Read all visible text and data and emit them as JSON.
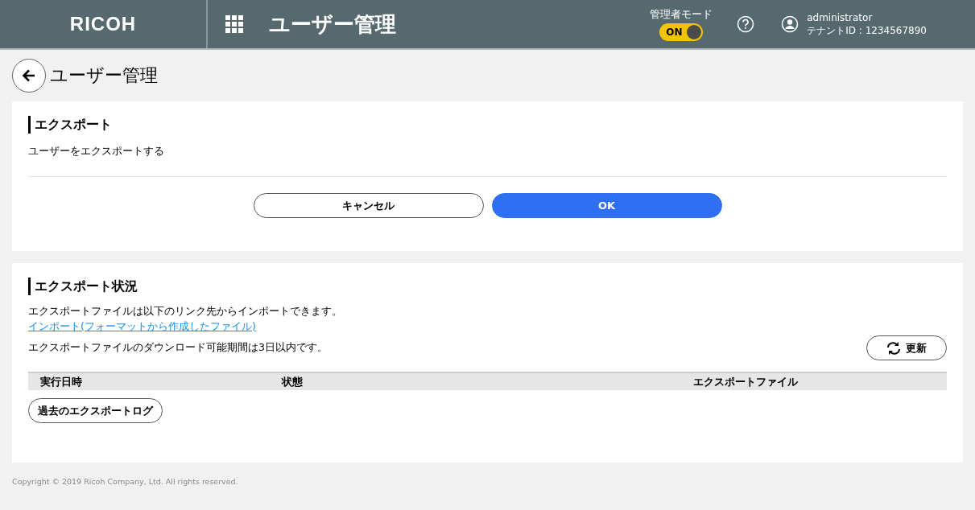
{
  "header": {
    "logo": "RICOH",
    "title": "ユーザー管理",
    "admin_mode": {
      "label": "管理者モード",
      "toggle_text": "ON",
      "on": true
    },
    "user": {
      "name": "administrator",
      "tenant": "テナントID : 1234567890"
    }
  },
  "page_title": "ユーザー管理",
  "export": {
    "title": "エクスポート",
    "description": "ユーザーをエクスポートする",
    "buttons": [
      {
        "label": "キャンセル",
        "kind": "secondary"
      },
      {
        "label": "OK",
        "kind": "primary"
      }
    ]
  },
  "status": {
    "title": "エクスポート状況",
    "note": "エクスポートファイルは以下のリンク先からインポートできます。",
    "link": "インポート(フォーマットから作成したファイル)",
    "period": "エクスポートファイルのダウンロード可能期間は3日以内です。",
    "refresh": "更新",
    "table": {
      "columns": [
        "実行日時",
        "状態",
        "エクスポートファイル"
      ]
    },
    "log_button": "過去のエクスポートログ"
  },
  "footer": "Copyright © 2019 Ricoh Company, Ltd. All rights reserved."
}
